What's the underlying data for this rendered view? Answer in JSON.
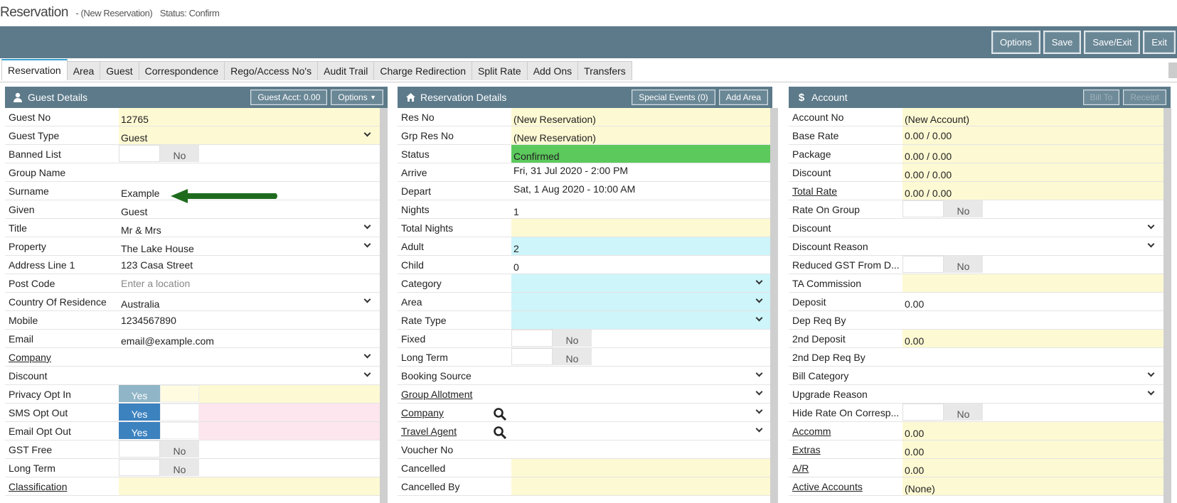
{
  "title": {
    "main": "Reservation",
    "sub": "- (New Reservation)",
    "status": "Status: Confirm"
  },
  "toolbar": {
    "options": "Options",
    "save": "Save",
    "save_exit": "Save/Exit",
    "exit": "Exit"
  },
  "tabs": [
    "Reservation",
    "Area",
    "Guest",
    "Correspondence",
    "Rego/Access No's",
    "Audit Trail",
    "Charge Redirection",
    "Split Rate",
    "Add Ons",
    "Transfers"
  ],
  "guest": {
    "title": "Guest Details",
    "acct_btn": "Guest Acct: 0.00",
    "options_btn": "Options",
    "labels": {
      "guest_no": "Guest No",
      "guest_type": "Guest Type",
      "banned": "Banned List",
      "group": "Group Name",
      "surname": "Surname",
      "given": "Given",
      "title": "Title",
      "property": "Property",
      "address": "Address Line 1",
      "postcode": "Post Code",
      "country": "Country Of Residence",
      "mobile": "Mobile",
      "email": "Email",
      "company": "Company",
      "discount": "Discount",
      "privacy": "Privacy Opt In",
      "sms": "SMS Opt Out",
      "emailopt": "Email Opt Out",
      "gst": "GST Free",
      "longterm": "Long Term",
      "classification": "Classification"
    },
    "values": {
      "guest_no": "12765",
      "guest_type": "Guest",
      "surname": "Example",
      "given": "Guest",
      "title": "Mr & Mrs",
      "property": "The Lake House",
      "address": "123 Casa Street",
      "postcode_placeholder": "Enter a location",
      "country": "Australia",
      "mobile": "1234567890",
      "email": "email@example.com"
    },
    "toggles": {
      "no": "No",
      "yes": "Yes"
    }
  },
  "reservation": {
    "title": "Reservation Details",
    "special_btn": "Special Events (0)",
    "area_btn": "Add Area",
    "labels": {
      "res_no": "Res No",
      "grp_res_no": "Grp Res No",
      "status": "Status",
      "arrive": "Arrive",
      "depart": "Depart",
      "nights": "Nights",
      "total_nights": "Total Nights",
      "adult": "Adult",
      "child": "Child",
      "category": "Category",
      "area": "Area",
      "rate_type": "Rate Type",
      "fixed": "Fixed",
      "long_term": "Long Term",
      "booking_source": "Booking Source",
      "group_allotment": "Group Allotment",
      "company": "Company",
      "travel_agent": "Travel Agent",
      "voucher": "Voucher No",
      "cancelled": "Cancelled",
      "cancelled_by": "Cancelled By"
    },
    "values": {
      "res_no": "(New Reservation)",
      "grp_res_no": "(New Reservation)",
      "status": "Confirmed",
      "arrive": "Fri, 31 Jul 2020 - 2:00 PM",
      "depart": "Sat, 1 Aug 2020 - 10:00 AM",
      "nights": "1",
      "adult": "2",
      "child": "0"
    }
  },
  "account": {
    "title": "Account",
    "bill_to": "Bill To",
    "receipt": "Receipt",
    "labels": {
      "account_no": "Account No",
      "base_rate": "Base Rate",
      "package": "Package",
      "discount": "Discount",
      "total_rate": "Total Rate",
      "rate_on_group": "Rate On Group",
      "discount2": "Discount",
      "discount_reason": "Discount Reason",
      "reduced_gst": "Reduced GST From D...",
      "ta_commission": "TA Commission",
      "deposit": "Deposit",
      "dep_req_by": "Dep Req By",
      "second_deposit": "2nd Deposit",
      "second_dep_req_by": "2nd Dep Req By",
      "bill_category": "Bill Category",
      "upgrade_reason": "Upgrade Reason",
      "hide_rate": "Hide Rate On Corresp...",
      "accomm": "Accomm",
      "extras": "Extras",
      "ar": "A/R",
      "active_accounts": "Active Accounts"
    },
    "values": {
      "account_no": "(New Account)",
      "base_rate": "0.00 / 0.00",
      "package": "0.00 / 0.00",
      "discount": "0.00 / 0.00",
      "total_rate": "0.00 / 0.00",
      "deposit": "0.00",
      "second_deposit": "0.00",
      "accomm": "0.00",
      "extras": "0.00",
      "ar": "0.00",
      "active_accounts": "(None)"
    }
  },
  "colors": {
    "header": "#5c7a8a",
    "yellow": "#fdf9d3",
    "cyan": "#cdf5fa",
    "green": "#5cc95c",
    "arrow": "#1e6b1e"
  }
}
